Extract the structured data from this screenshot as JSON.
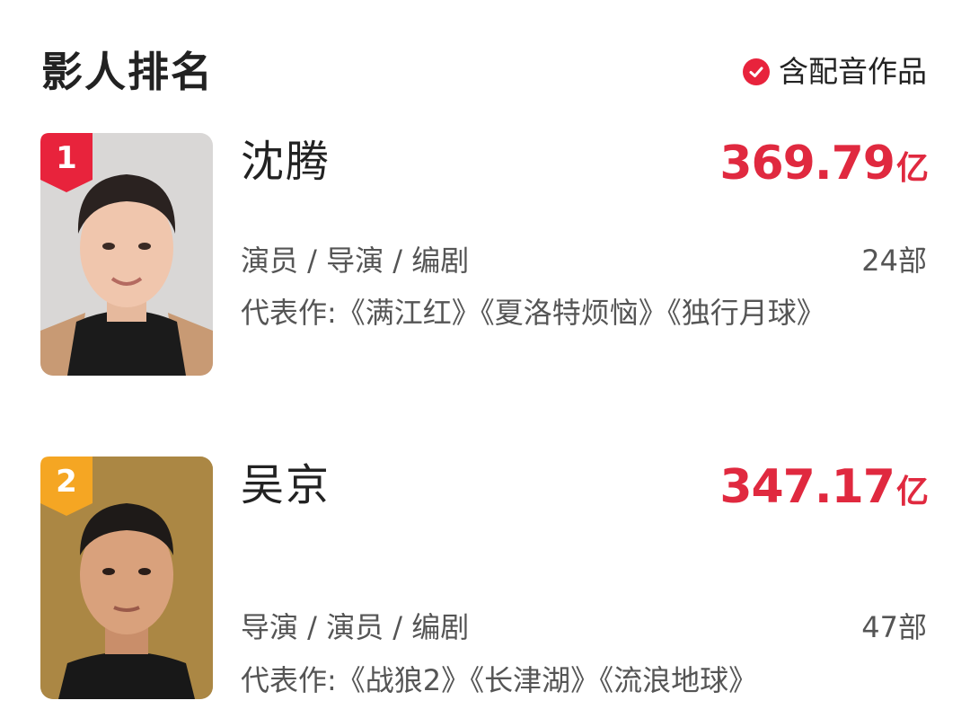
{
  "header": {
    "title": "影人排名",
    "filter_label": "含配音作品"
  },
  "colors": {
    "accent_red": "#e0293f",
    "rank1_badge": "#e8233c",
    "rank2_badge": "#f5a623"
  },
  "people": [
    {
      "rank": "1",
      "name": "沈腾",
      "box_office": "369.79",
      "unit": "亿",
      "roles": "演员 / 导演 / 编剧",
      "count": "24部",
      "works": "代表作:《满江红》《夏洛特烦恼》《独行月球》"
    },
    {
      "rank": "2",
      "name": "吴京",
      "box_office": "347.17",
      "unit": "亿",
      "roles": "导演 / 演员 / 编剧",
      "count": "47部",
      "works": "代表作:《战狼2》《长津湖》《流浪地球》"
    }
  ]
}
